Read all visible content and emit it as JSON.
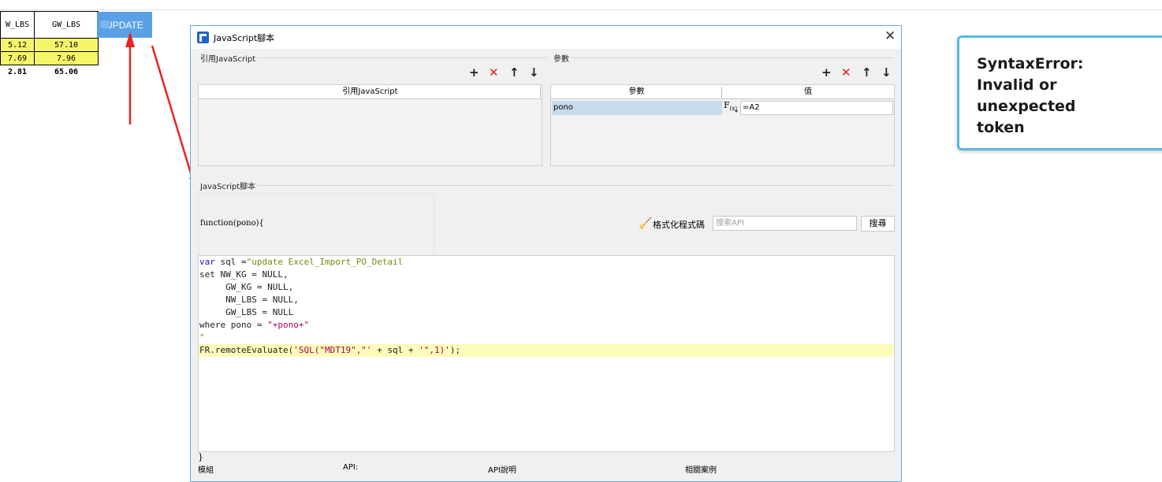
{
  "sheet": {
    "headers": [
      "W_LBS",
      "GW_LBS"
    ],
    "rows": [
      [
        "5.12",
        "57.10"
      ],
      [
        "7.69",
        "7.96"
      ]
    ],
    "totals": [
      "2.81",
      "65.06"
    ]
  },
  "update_button": {
    "label": "UPDATE"
  },
  "dialog": {
    "title": "JavaScript腳本",
    "ref_section": {
      "label": "引用JavaScript",
      "column_header": "引用JavaScript"
    },
    "params_section": {
      "label": "參數",
      "column_headers": [
        "參數",
        "值"
      ],
      "rows": [
        {
          "name": "pono",
          "value": "=A2"
        }
      ]
    },
    "script_section": {
      "label": "JavaScript腳本"
    },
    "function_signature": "function(pono){",
    "format_label": "格式化程式碼",
    "search_placeholder": "搜索API",
    "search_button": "搜尋",
    "code": {
      "l1_kw": "var",
      "l1_mid": " sql =",
      "l1_str": "\"update Excel_Import_PO_Detail",
      "l2": "set NW_KG = NULL,",
      "l3": "     GW_KG = NULL,",
      "l4": "     NW_LBS = NULL,",
      "l5": "     GW_LBS = NULL",
      "l6_a": "where pono = ",
      "l6_str": "\"+pono+\"",
      "l7": "\"",
      "l8_a": "FR.remoteEvaluate(",
      "l8_str1": "'SQL(\"MDT19\",\"' ",
      "l8_b": "+ sql + ",
      "l8_str2": "'\",1)'",
      "l8_c": ");"
    },
    "closing_brace": "}",
    "bottom_labels": [
      "模組",
      "API:",
      "API說明",
      "相關案例"
    ]
  },
  "error_panel": {
    "text": "SyntaxError: Invalid or unexpected token"
  },
  "colors": {
    "accent": "#5aa0e6",
    "highlight": "#f5f56a",
    "error_border": "#5bb9dc",
    "arrow": "#e8231f"
  },
  "icons": [
    "add-icon",
    "delete-icon",
    "move-up-icon",
    "move-down-icon",
    "formula-icon",
    "broom-icon",
    "close-icon",
    "app-logo-icon"
  ]
}
